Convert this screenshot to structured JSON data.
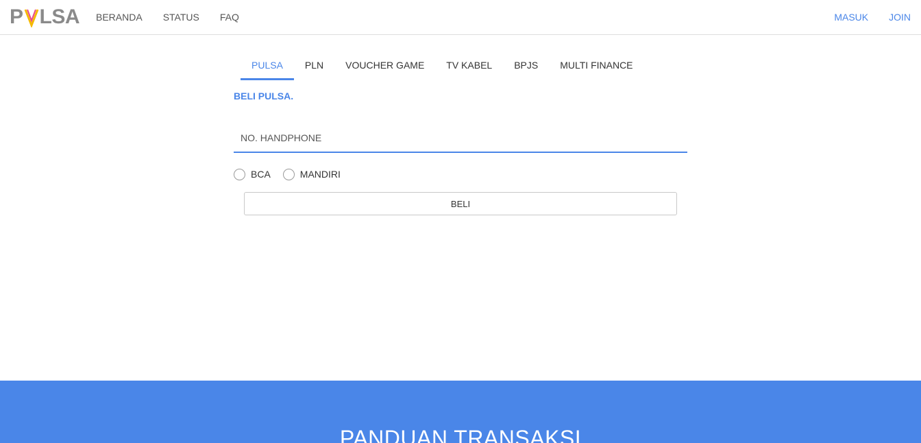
{
  "brand": {
    "logo_left": "P",
    "logo_right": "LSA",
    "logo_full": "PVLSA",
    "colors": {
      "accent": "#4a86e8",
      "logo_gray": "#8a8a8a",
      "logo_v": [
        "#e84a8a",
        "#f5b800"
      ]
    }
  },
  "nav": {
    "left": [
      "BERANDA",
      "STATUS",
      "FAQ"
    ],
    "right": [
      "MASUK",
      "JOIN"
    ]
  },
  "tabs": [
    {
      "label": "PULSA",
      "active": true
    },
    {
      "label": "PLN",
      "active": false
    },
    {
      "label": "VOUCHER GAME",
      "active": false
    },
    {
      "label": "TV KABEL",
      "active": false
    },
    {
      "label": "BPJS",
      "active": false
    },
    {
      "label": "MULTI FINANCE",
      "active": false
    }
  ],
  "form": {
    "title": "BELI PULSA.",
    "phone_placeholder": "NO. HANDPHONE",
    "phone_value": "",
    "payment_options": [
      "BCA",
      "MANDIRI"
    ],
    "buy_label": "BELI"
  },
  "guide": {
    "title": "PANDUAN TRANSAKSI"
  }
}
